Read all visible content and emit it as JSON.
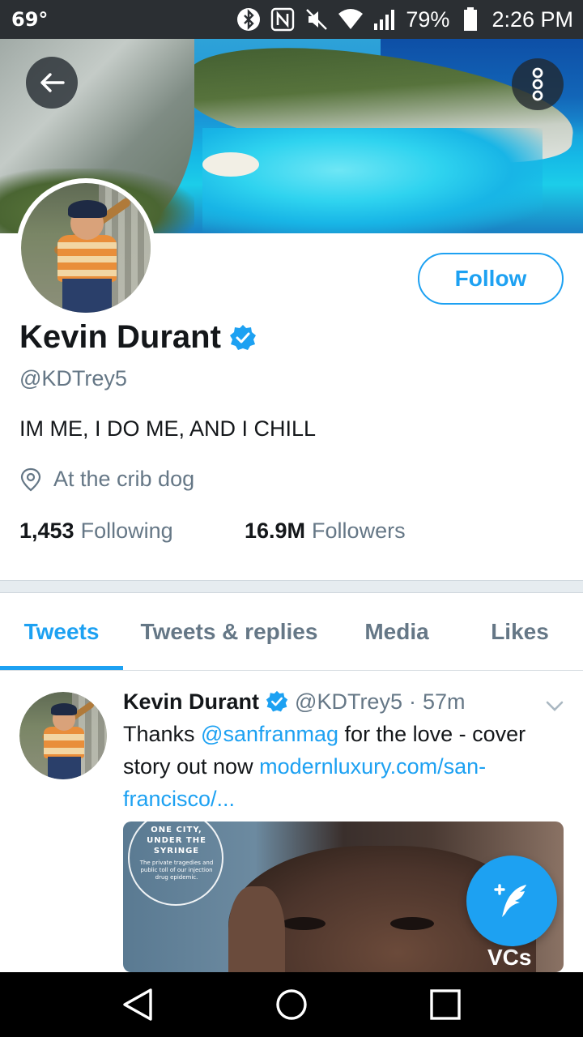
{
  "status_bar": {
    "temperature": "69°",
    "battery": "79%",
    "time": "2:26 PM"
  },
  "header": {
    "back_icon": "arrow-left-icon",
    "more_icon": "more-vertical-icon"
  },
  "profile": {
    "name": "Kevin Durant",
    "handle": "@KDTrey5",
    "bio": "IM ME, I DO ME, AND I CHILL",
    "location": "At the crib dog",
    "follow_label": "Follow",
    "following_count": "1,453",
    "following_label": "Following",
    "followers_count": "16.9M",
    "followers_label": "Followers"
  },
  "tabs": [
    {
      "label": "Tweets",
      "active": true
    },
    {
      "label": "Tweets & replies",
      "active": false
    },
    {
      "label": "Media",
      "active": false
    },
    {
      "label": "Likes",
      "active": false
    }
  ],
  "tweet": {
    "name": "Kevin Durant",
    "handle": "@KDTrey5",
    "dot": "·",
    "time": "57m",
    "text_before": "Thanks ",
    "mention": "@sanfranmag",
    "text_middle": " for the love - cover story out now ",
    "link": "modernluxury.com/san-francisco/...",
    "media": {
      "cover_headline": "ONE CITY, UNDER THE SYRINGE",
      "cover_subhead": "The private tragedies and public toll of our injection drug epidemic.",
      "cover_side_text": "VCs"
    }
  },
  "colors": {
    "accent": "#1da1f2",
    "text": "#14171a",
    "secondary_text": "#657786",
    "status_bar": "#2b2f33"
  }
}
